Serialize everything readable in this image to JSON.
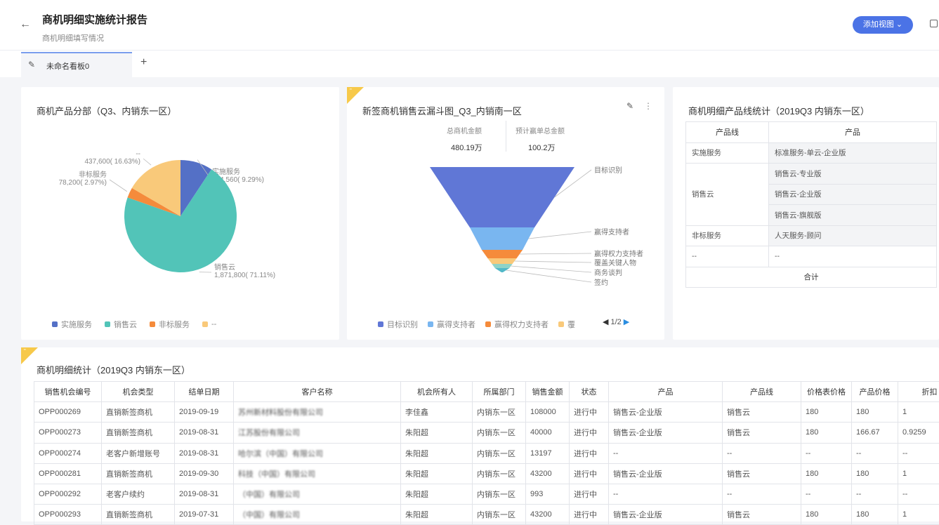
{
  "header": {
    "back_icon": "arrow-left-icon",
    "title": "商机明细实施统计报告",
    "subtitle": "商机明细填写情况",
    "add_view": "添加视图",
    "share_icon": "share-icon"
  },
  "tabs": [
    {
      "label": "未命名看板0",
      "icon": "pencil-icon"
    }
  ],
  "pie_card": {
    "title": "商机产品分部（Q3、内销东一区）",
    "chart_data": {
      "type": "pie",
      "title": "商机产品分部（Q3、内销东一区）",
      "slices": [
        {
          "name": "实施服务",
          "value": 244560,
          "label": "244,560( 9.29%)",
          "color": "#5470c6"
        },
        {
          "name": "销售云",
          "value": 1871800,
          "label": "1,871,800( 71.11%)",
          "color": "#52c4b8"
        },
        {
          "name": "非标服务",
          "value": 78200,
          "label": "78,200( 2.97%)",
          "color": "#f58b3b"
        },
        {
          "name": "--",
          "value": 437600,
          "label": "437,600( 16.63%)",
          "color": "#f9c97a"
        }
      ]
    }
  },
  "funnel_card": {
    "title": "新签商机销售云漏斗图_Q3_内销南一区",
    "corner_mark": "\"",
    "metric1_label": "总商机金额",
    "metric1_value": "480.19万",
    "metric2_label": "预计赢单总金额",
    "metric2_value": "100.2万",
    "page_indicator": "1/2",
    "edit_icon": "pencil-icon",
    "more_icon": "more-vertical-icon",
    "chart_data": {
      "type": "funnel",
      "title": "新签商机销售云漏斗图_Q3_内销南一区",
      "stages": [
        {
          "name": "目标识别",
          "legend": "目标识别",
          "value": 100,
          "color": "#6077d6"
        },
        {
          "name": "赢得支持者",
          "legend": "赢得支持者",
          "value": 20,
          "color": "#79b6f0"
        },
        {
          "name": "赢得权力支持者",
          "legend": "赢得权力支持者",
          "value": 8,
          "color": "#f58b3b"
        },
        {
          "name": "覆盖关键人物",
          "legend": "覆",
          "value": 4,
          "color": "#f9c97a"
        },
        {
          "name": "商务谈判",
          "value": 2,
          "color": "#8fd3c8"
        },
        {
          "name": "签约",
          "value": 1,
          "color": "#52b8c8"
        }
      ]
    }
  },
  "product_card": {
    "title": "商机明细产品线统计（2019Q3 内销东一区）",
    "headers": [
      "产品线",
      "产品"
    ],
    "groups": [
      {
        "line": "实施服务",
        "products": [
          "标准服务-单云-企业版"
        ]
      },
      {
        "line": "销售云",
        "products": [
          "销售云-专业版",
          "销售云-企业版",
          "销售云-旗舰版"
        ]
      },
      {
        "line": "非标服务",
        "products": [
          "人天服务-顾问"
        ]
      },
      {
        "line": "--",
        "products": [
          "--"
        ]
      }
    ],
    "total_label": "合计"
  },
  "detail_card": {
    "title": "商机明细统计（2019Q3 内销东一区）",
    "corner_mark": "\"",
    "headers": [
      "销售机会编号",
      "机会类型",
      "结单日期",
      "客户名称",
      "机会所有人",
      "所属部门",
      "销售金额",
      "状态",
      "产品",
      "产品线",
      "价格表价格",
      "产品价格",
      "折扣"
    ],
    "rows": [
      [
        "OPP000269",
        "直销新签商机",
        "2019-09-19",
        "苏州新材料股份有限公司",
        "李佳鑫",
        "内销东一区",
        "108000",
        "进行中",
        "销售云-企业版",
        "销售云",
        "180",
        "180",
        "1"
      ],
      [
        "OPP000273",
        "直销新签商机",
        "2019-08-31",
        "江苏股份有限公司",
        "朱阳超",
        "内销东一区",
        "40000",
        "进行中",
        "销售云-企业版",
        "销售云",
        "180",
        "166.67",
        "0.9259"
      ],
      [
        "OPP000274",
        "老客户新增账号",
        "2019-08-31",
        "哈尔滨（中国）有限公司",
        "朱阳超",
        "内销东一区",
        "13197",
        "进行中",
        "--",
        "--",
        "--",
        "--",
        "--"
      ],
      [
        "OPP000281",
        "直销新签商机",
        "2019-09-30",
        "科技（中国）有限公司",
        "朱阳超",
        "内销东一区",
        "43200",
        "进行中",
        "销售云-企业版",
        "销售云",
        "180",
        "180",
        "1"
      ],
      [
        "OPP000292",
        "老客户续约",
        "2019-08-31",
        "（中国）有限公司",
        "朱阳超",
        "内销东一区",
        "993",
        "进行中",
        "--",
        "--",
        "--",
        "--",
        "--"
      ],
      [
        "OPP000293",
        "直销新签商机",
        "2019-07-31",
        "（中国）有限公司",
        "朱阳超",
        "内销东一区",
        "43200",
        "进行中",
        "销售云-企业版",
        "销售云",
        "180",
        "180",
        "1"
      ]
    ]
  }
}
